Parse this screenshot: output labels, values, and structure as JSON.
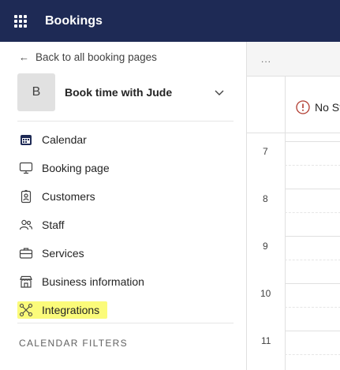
{
  "app": {
    "title": "Bookings"
  },
  "sidebar": {
    "back_link": "Back to all booking pages",
    "booking_page": {
      "avatar_letter": "B",
      "name": "Book time with Jude"
    },
    "nav": [
      {
        "label": "Calendar",
        "icon": "calendar-icon"
      },
      {
        "label": "Booking page",
        "icon": "monitor-icon"
      },
      {
        "label": "Customers",
        "icon": "contact-card-icon"
      },
      {
        "label": "Staff",
        "icon": "people-icon"
      },
      {
        "label": "Services",
        "icon": "briefcase-icon"
      },
      {
        "label": "Business information",
        "icon": "storefront-icon"
      },
      {
        "label": "Integrations",
        "icon": "nodes-icon"
      }
    ],
    "filters_heading": "CALENDAR FILTERS"
  },
  "main": {
    "toolbar_more": "...",
    "staff_header": "No St",
    "hours": [
      "7",
      "8",
      "9",
      "10",
      "11"
    ]
  },
  "colors": {
    "topbar": "#1e2a55",
    "highlight": "#fbfb7a",
    "warning": "#b03a2e"
  }
}
